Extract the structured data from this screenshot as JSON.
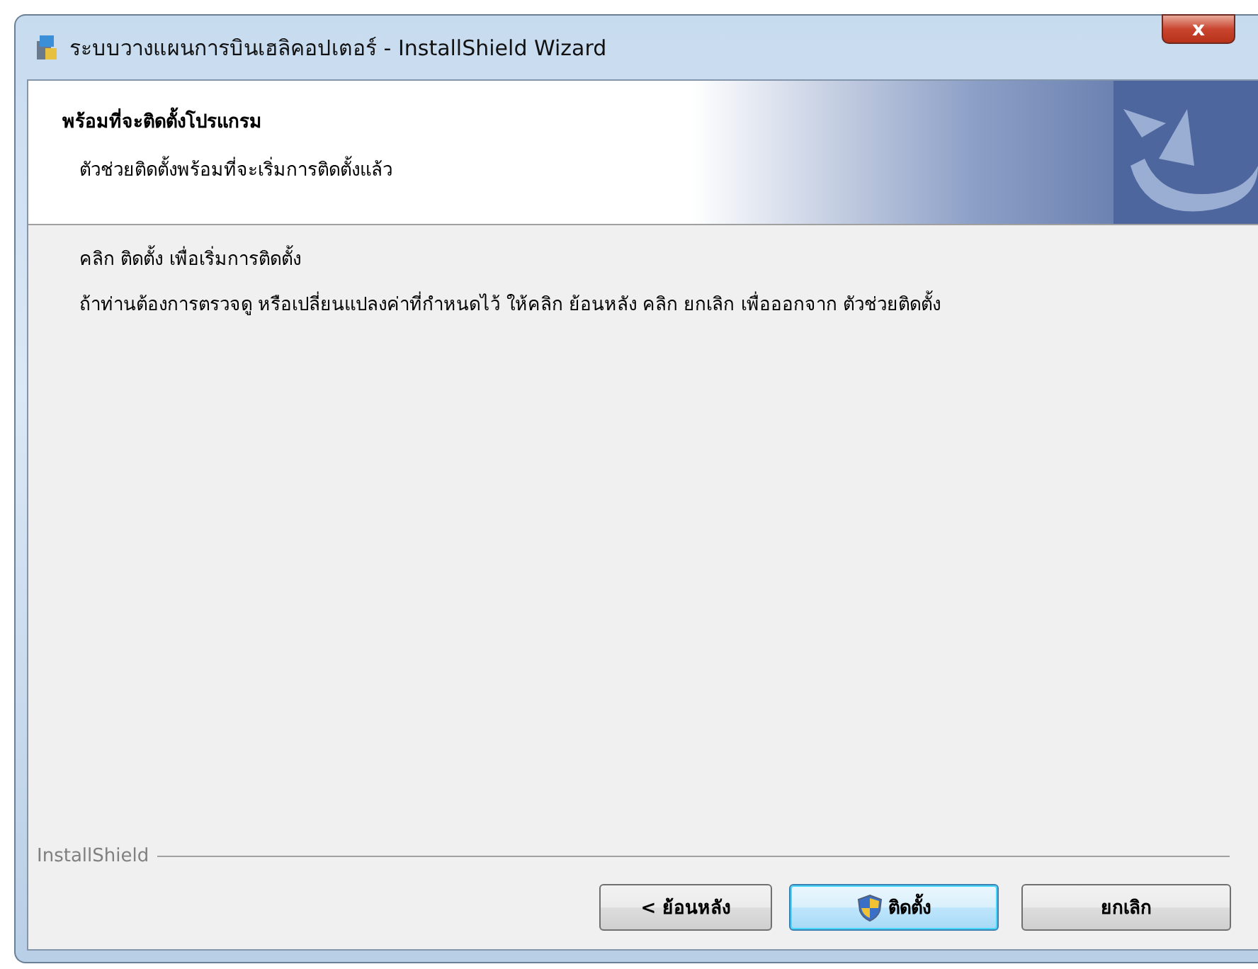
{
  "window": {
    "title": "ระบบวางแผนการบินเฮลิคอปเตอร์ - InstallShield Wizard",
    "close": "x"
  },
  "header": {
    "title": "พร้อมที่จะติดตั้งโปรแกรม",
    "subtitle": "ตัวช่วยติดตั้งพร้อมที่จะเริ่มการติดตั้งแล้ว"
  },
  "paragraphs": [
    "คลิก ติดตั้ง เพื่อเริ่มการติดตั้ง",
    "ถ้าท่านต้องการตรวจดู หรือเปลี่ยนแปลงค่าที่กำหนดไว้ ให้คลิก ย้อนหลัง คลิก ยกเลิก เพื่อออกจาก ตัวช่วยติดตั้ง"
  ],
  "brand": "InstallShield",
  "buttons": [
    {
      "label": "< ย้อนหลัง",
      "kind": "plain",
      "default": false
    },
    {
      "label": "ติดตั้ง",
      "kind": "elevated",
      "default": true
    },
    {
      "label": "ยกเลิก",
      "kind": "plain",
      "default": false
    }
  ]
}
